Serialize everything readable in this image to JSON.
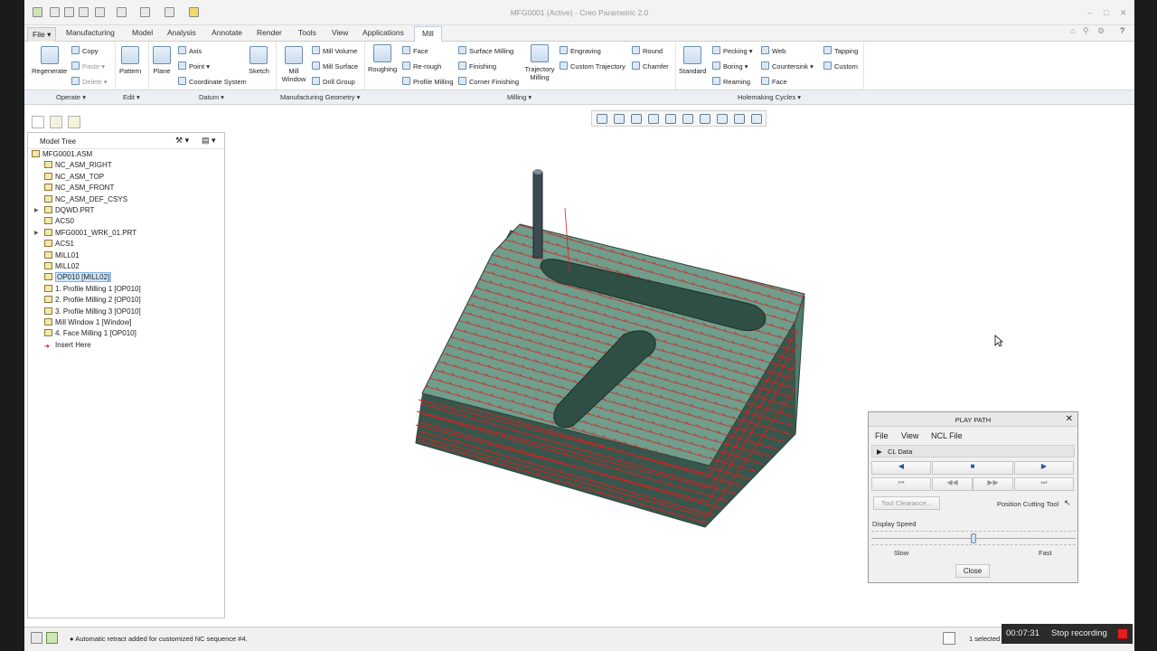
{
  "window": {
    "title": "MFG0001 (Active) - Creo Parametric 2.0"
  },
  "tabs": {
    "file": "File",
    "items": [
      "Manufacturing",
      "Model",
      "Analysis",
      "Annotate",
      "Render",
      "Tools",
      "View",
      "Applications",
      "Mill"
    ],
    "active": "Mill"
  },
  "ribbon": {
    "regenerate": "Regenerate",
    "copy": "Copy",
    "paste": "Paste",
    "delete": "Delete",
    "pattern": "Pattern",
    "plane": "Plane",
    "axis": "Axis",
    "point": "Point",
    "coord": "Coordinate System",
    "sketch": "Sketch",
    "mill_window": "Mill Window",
    "mill_volume": "Mill Volume",
    "mill_surface": "Mill Surface",
    "drill_group": "Drill Group",
    "roughing": "Roughing",
    "face": "Face",
    "rerough": "Re-rough",
    "profile_milling": "Profile Milling",
    "surface_milling": "Surface Milling",
    "finishing": "Finishing",
    "corner_finishing": "Corner Finishing",
    "trajectory_milling": "Trajectory Milling",
    "engraving": "Engraving",
    "custom_trajectory": "Custom Trajectory",
    "round": "Round",
    "chamfer": "Chamfer",
    "standard": "Standard",
    "pecking": "Pecking",
    "boring": "Boring",
    "reaming": "Reaming",
    "web": "Web",
    "countersink": "Countersink",
    "face2": "Face",
    "tapping": "Tapping",
    "custom": "Custom"
  },
  "groups": [
    "Operate",
    "Edit",
    "Datum",
    "Manufacturing Geometry",
    "Milling",
    "Holemaking Cycles"
  ],
  "model_tree": {
    "title": "Model Tree",
    "items": [
      "MFG0001.ASM",
      "NC_ASM_RIGHT",
      "NC_ASM_TOP",
      "NC_ASM_FRONT",
      "NC_ASM_DEF_CSYS",
      "DQWD.PRT",
      "ACS0",
      "MFG0001_WRK_01.PRT",
      "ACS1",
      "MILL01",
      "MILL02",
      "OP010 [MILL02]",
      "1. Profile Milling 1 [OP010]",
      "2. Profile Milling 2 [OP010]",
      "3. Profile Milling 3 [OP010]",
      "Mill Window 1 [Window]",
      "4. Face Milling 1 [OP010]",
      "Insert Here"
    ]
  },
  "play_path": {
    "title": "PLAY PATH",
    "menu": [
      "File",
      "View",
      "NCL File"
    ],
    "cl_data": "CL Data",
    "tool_clearance": "Tool Clearance...",
    "position_tool": "Position Cutting Tool",
    "display_speed": "Display Speed",
    "slow": "Slow",
    "fast": "Fast",
    "close": "Close",
    "speed": 0.5
  },
  "status": {
    "message": "Automatic retract added for customized NC sequence #4.",
    "selected": "1 selected"
  },
  "recording": {
    "time": "00:07:31",
    "label": "Stop recording"
  },
  "colors": {
    "part": "#5b8a78",
    "toolpath": "#d42020",
    "highlight": "#cde6fb"
  }
}
